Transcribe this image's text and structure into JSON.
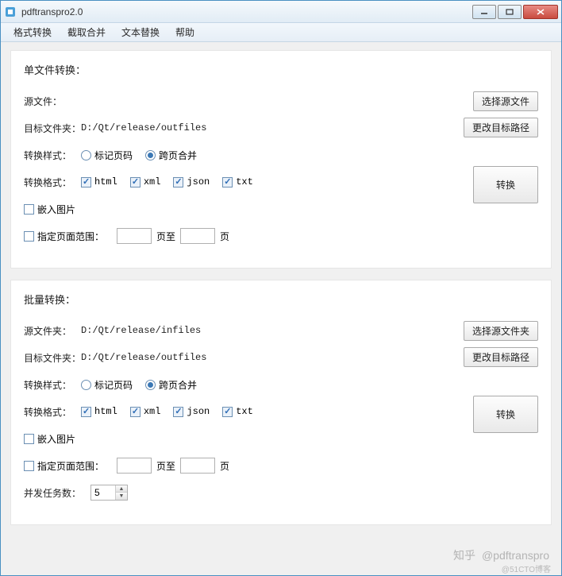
{
  "window": {
    "title": "pdftranspro2.0"
  },
  "menu": {
    "items": [
      "格式转换",
      "截取合并",
      "文本替换",
      "帮助"
    ]
  },
  "single": {
    "title": "单文件转换：",
    "source_label": "源文件：",
    "source_value": "",
    "select_btn": "选择源文件",
    "target_label": "目标文件夹：",
    "target_value": "D:/Qt/release/outfiles",
    "change_btn": "更改目标路径",
    "style_label": "转换样式：",
    "style_options": [
      "标记页码",
      "跨页合并"
    ],
    "style_selected": 1,
    "format_label": "转换格式：",
    "formats": [
      "html",
      "xml",
      "json",
      "txt"
    ],
    "formats_checked": [
      true,
      true,
      true,
      true
    ],
    "embed_label": "嵌入图片",
    "embed_checked": false,
    "range_label": "指定页面范围：",
    "range_checked": false,
    "range_from": "",
    "range_to_label": "页至",
    "range_to": "",
    "range_end_label": "页",
    "convert_btn": "转换"
  },
  "batch": {
    "title": "批量转换：",
    "source_label": "源文件夹：",
    "source_value": "D:/Qt/release/infiles",
    "select_btn": "选择源文件夹",
    "target_label": "目标文件夹：",
    "target_value": "D:/Qt/release/outfiles",
    "change_btn": "更改目标路径",
    "style_label": "转换样式：",
    "style_options": [
      "标记页码",
      "跨页合并"
    ],
    "style_selected": 1,
    "format_label": "转换格式：",
    "formats": [
      "html",
      "xml",
      "json",
      "txt"
    ],
    "formats_checked": [
      true,
      true,
      true,
      true
    ],
    "embed_label": "嵌入图片",
    "embed_checked": false,
    "range_label": "指定页面范围：",
    "range_checked": false,
    "range_from": "",
    "range_to_label": "页至",
    "range_to": "",
    "range_end_label": "页",
    "concurrent_label": "并发任务数：",
    "concurrent_value": "5",
    "convert_btn": "转换"
  },
  "watermark": {
    "brand": "知乎",
    "handle": "@pdftranspro",
    "sub": "@51CTO博客"
  }
}
